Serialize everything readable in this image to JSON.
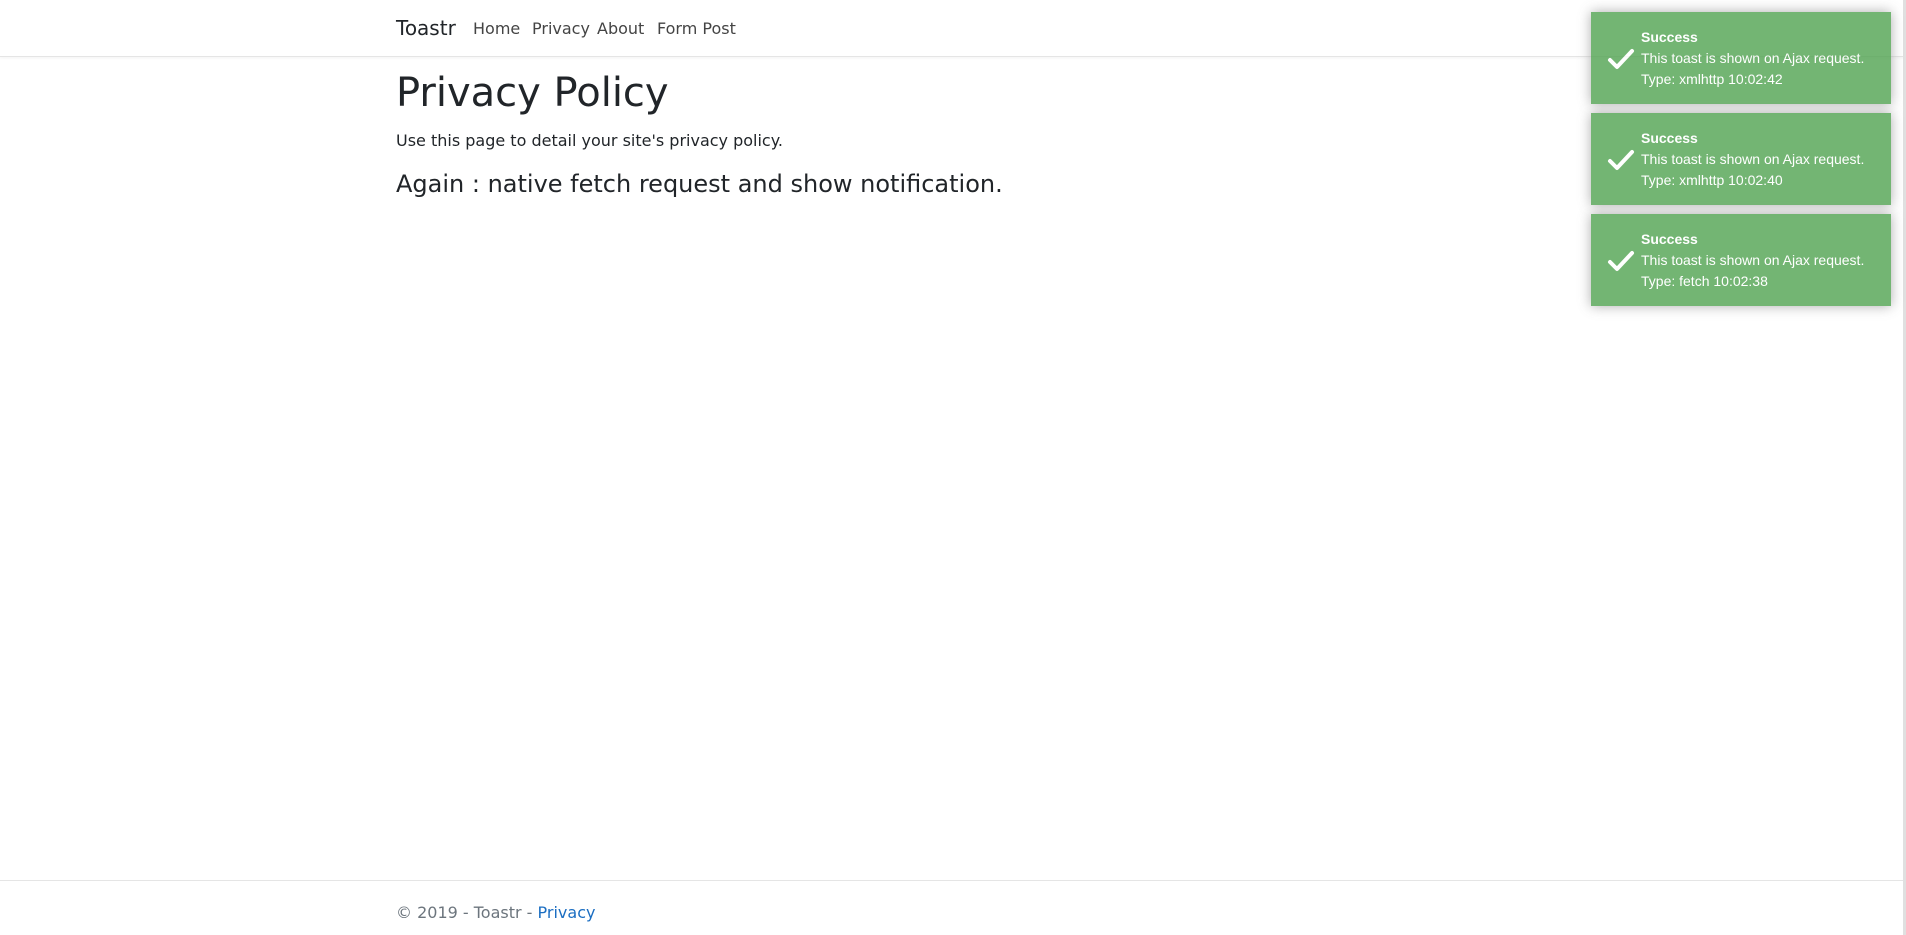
{
  "navbar": {
    "brand": "Toastr",
    "links": [
      "Home",
      "Privacy",
      "About",
      "Form Post"
    ]
  },
  "main": {
    "title": "Privacy Policy",
    "description": "Use this page to detail your site's privacy policy.",
    "subheading": "Again : native fetch request and show notification."
  },
  "footer": {
    "copyright": "© 2019 - Toastr - ",
    "link": "Privacy"
  },
  "toasts": [
    {
      "title": "Success",
      "message": "This toast is shown on Ajax request.",
      "detail": "Type: xmlhttp 10:02:42",
      "icon": "checkmark-icon",
      "color": "#51a351"
    },
    {
      "title": "Success",
      "message": "This toast is shown on Ajax request.",
      "detail": "Type: xmlhttp 10:02:40",
      "icon": "checkmark-icon",
      "color": "#51a351"
    },
    {
      "title": "Success",
      "message": "This toast is shown on Ajax request.",
      "detail": "Type: fetch 10:02:38",
      "icon": "checkmark-icon",
      "color": "#51a351"
    }
  ]
}
